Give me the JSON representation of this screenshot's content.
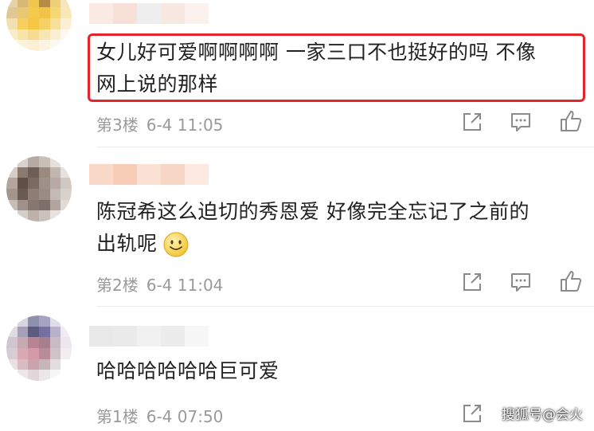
{
  "comments": [
    {
      "text_line1": "女儿好可爱啊啊啊啊 一家三口不也挺好的吗 不像",
      "text_line2": "网上说的那样",
      "floor": "第3楼",
      "time": "6-4 11:05"
    },
    {
      "text_line1": "陈冠希这么迫切的秀恩爱 好像完全忘记了之前的",
      "text_line2": "出轨呢",
      "floor": "第2楼",
      "time": "6-4 11:04"
    },
    {
      "text_line1": "哈哈哈哈哈哈巨可爱",
      "floor": "第1楼",
      "time": "6-4 07:50"
    }
  ],
  "watermark": "搜狐号@会火",
  "colors": {
    "highlight_border": "#e3242b",
    "meta_text": "#9a9a9a",
    "body_text": "#222222"
  },
  "icons": [
    "share-icon",
    "reply-icon",
    "like-icon"
  ]
}
